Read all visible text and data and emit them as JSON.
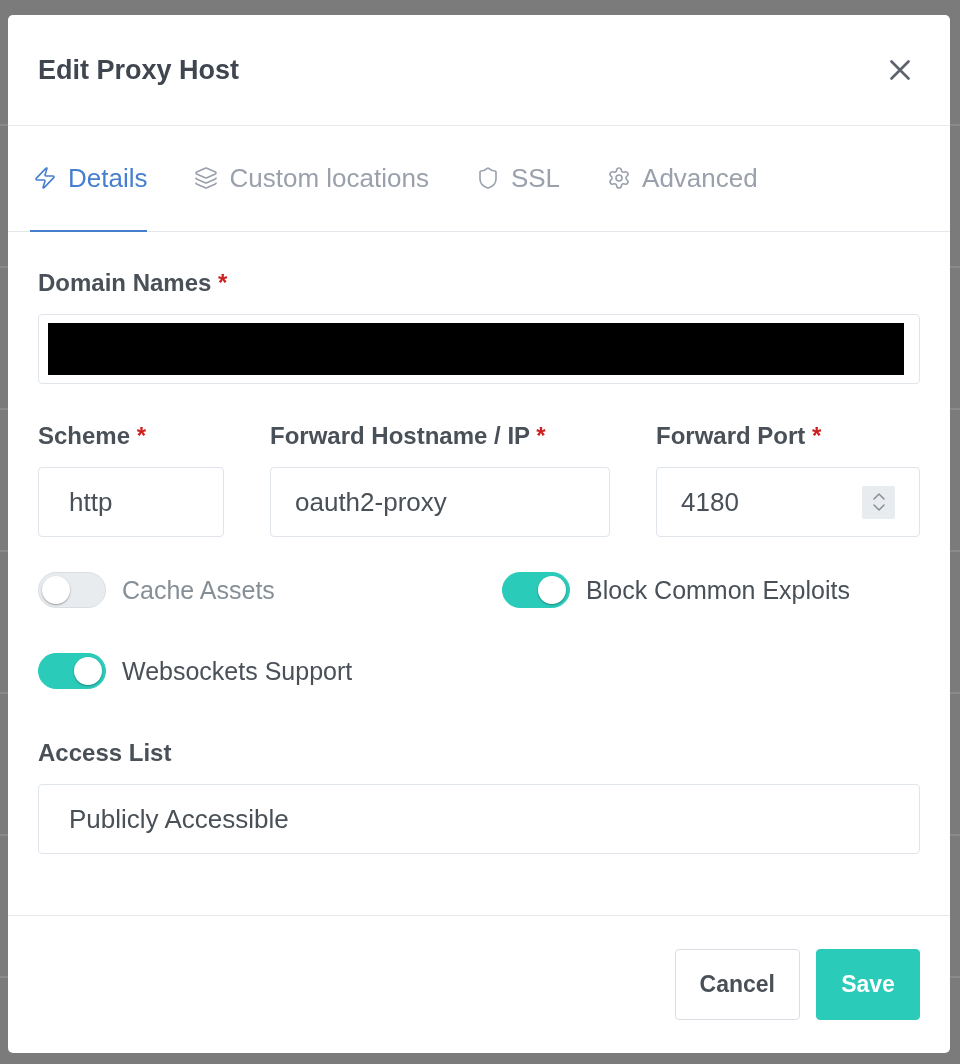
{
  "dialog": {
    "title": "Edit Proxy Host"
  },
  "tabs": [
    {
      "label": "Details",
      "selected": true
    },
    {
      "label": "Custom locations",
      "selected": false
    },
    {
      "label": "SSL",
      "selected": false
    },
    {
      "label": "Advanced",
      "selected": false
    }
  ],
  "required_marker": "*",
  "domain_names": {
    "label": "Domain Names",
    "required": true,
    "kind": "text",
    "redacted": true
  },
  "forward_fields": [
    {
      "label": "Scheme",
      "required": true,
      "kind": "select",
      "value": "http"
    },
    {
      "label": "Forward Hostname / IP",
      "required": true,
      "kind": "text",
      "value": "oauth2-proxy"
    },
    {
      "label": "Forward Port",
      "required": true,
      "kind": "number",
      "value": "4180"
    }
  ],
  "toggles": [
    {
      "label": "Cache Assets",
      "on": false
    },
    {
      "label": "Block Common Exploits",
      "on": true
    },
    {
      "label": "Websockets Support",
      "on": true
    }
  ],
  "access_list": {
    "label": "Access List",
    "required": false,
    "kind": "select",
    "value": "Publicly Accessible"
  },
  "buttons": [
    {
      "label": "Cancel",
      "kind": "cancel"
    },
    {
      "label": "Save",
      "kind": "save"
    }
  ]
}
